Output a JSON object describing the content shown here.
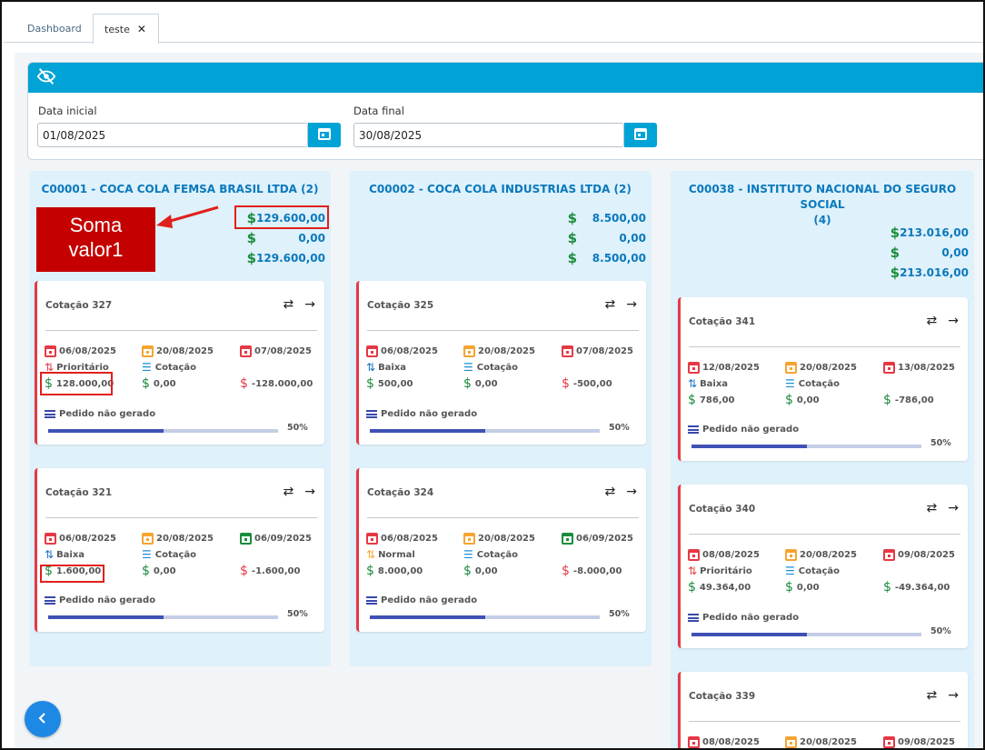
{
  "tabs": [
    {
      "label": "Dashboard"
    },
    {
      "label": "teste",
      "close": "✕"
    }
  ],
  "filters": {
    "start_label": "Data inicial",
    "start_value": "01/08/2025",
    "end_label": "Data final",
    "end_value": "30/08/2025"
  },
  "annotation": {
    "line1": "Soma",
    "line2": "valor1"
  },
  "columns": [
    {
      "title": "C00001 - COCA COLA FEMSA BRASIL LTDA (2)",
      "totals": [
        "129.600,00",
        "0,00",
        "129.600,00"
      ],
      "cards": [
        {
          "title": "Cotação 327",
          "date1": "06/08/2025",
          "date2": "20/08/2025",
          "date3": "07/08/2025",
          "priority": "Prioritário",
          "status": "Cotação",
          "v1": "128.000,00",
          "v2": "0,00",
          "v3": "-128.000,00",
          "order": "Pedido não gerado",
          "progress": "50%"
        },
        {
          "title": "Cotação 321",
          "date1": "06/08/2025",
          "date2": "20/08/2025",
          "date3": "06/09/2025",
          "priority": "Baixa",
          "status": "Cotação",
          "v1": "1.600,00",
          "v2": "0,00",
          "v3": "-1.600,00",
          "order": "Pedido não gerado",
          "progress": "50%"
        }
      ]
    },
    {
      "title": "C00002 - COCA COLA INDUSTRIAS LTDA (2)",
      "totals": [
        "8.500,00",
        "0,00",
        "8.500,00"
      ],
      "cards": [
        {
          "title": "Cotação 325",
          "date1": "06/08/2025",
          "date2": "20/08/2025",
          "date3": "07/08/2025",
          "priority": "Baixa",
          "status": "Cotação",
          "v1": "500,00",
          "v2": "0,00",
          "v3": "-500,00",
          "order": "Pedido não gerado",
          "progress": "50%"
        },
        {
          "title": "Cotação 324",
          "date1": "06/08/2025",
          "date2": "20/08/2025",
          "date3": "06/09/2025",
          "priority": "Normal",
          "status": "Cotação",
          "v1": "8.000,00",
          "v2": "0,00",
          "v3": "-8.000,00",
          "order": "Pedido não gerado",
          "progress": "50%"
        }
      ]
    },
    {
      "title_line1": "C00038 - INSTITUTO NACIONAL DO SEGURO SOCIAL",
      "title_line2": "(4)",
      "totals": [
        "213.016,00",
        "0,00",
        "213.016,00"
      ],
      "cards": [
        {
          "title": "Cotação 341",
          "date1": "12/08/2025",
          "date2": "20/08/2025",
          "date3": "13/08/2025",
          "priority": "Baixa",
          "status": "Cotação",
          "v1": "786,00",
          "v2": "0,00",
          "v3": "-786,00",
          "order": "Pedido não gerado",
          "progress": "50%"
        },
        {
          "title": "Cotação 340",
          "date1": "08/08/2025",
          "date2": "20/08/2025",
          "date3": "09/08/2025",
          "priority": "Prioritário",
          "status": "Cotação",
          "v1": "49.364,00",
          "v2": "0,00",
          "v3": "-49.364,00",
          "order": "Pedido não gerado",
          "progress": "50%"
        },
        {
          "title": "Cotação 339",
          "date1": "08/08/2025",
          "date2": "20/08/2025",
          "date3": "09/08/2025"
        }
      ]
    }
  ]
}
